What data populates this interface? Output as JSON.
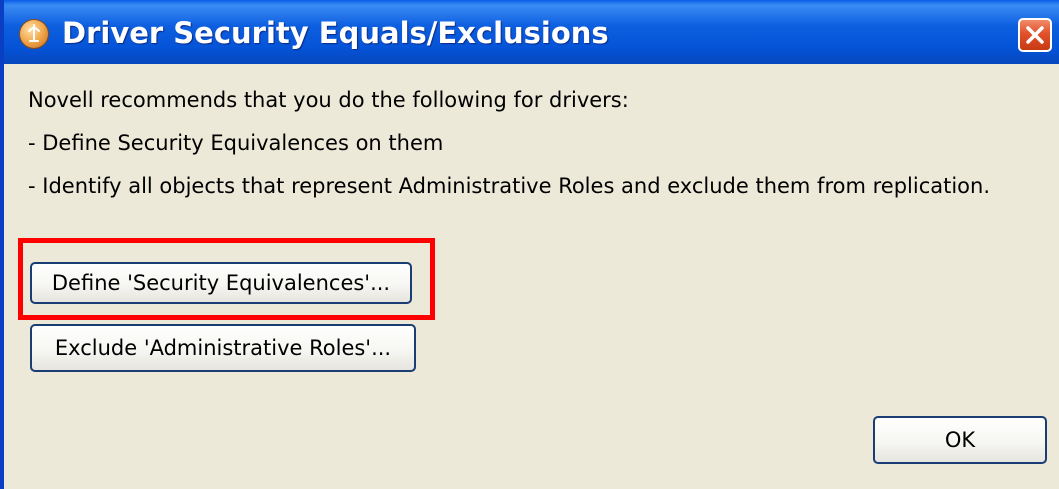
{
  "window": {
    "title": "Driver Security Equals/Exclusions",
    "app_icon": "novell-app-icon",
    "close_icon": "close-icon",
    "accent_color": "#0a5ce8",
    "close_color": "#e2512c"
  },
  "message": {
    "line1": "Novell recommends that you do the following for drivers:",
    "line2": "- Define Security Equivalences on them",
    "line3": "- Identify all objects that represent Administrative Roles and exclude them from replication."
  },
  "buttons": {
    "define_label": "Define 'Security Equivalences'...",
    "exclude_label": "Exclude 'Administrative Roles'...",
    "ok_label": "OK"
  },
  "highlight": {
    "color": "#ff0000",
    "target": "define-security-equivalences-button"
  }
}
